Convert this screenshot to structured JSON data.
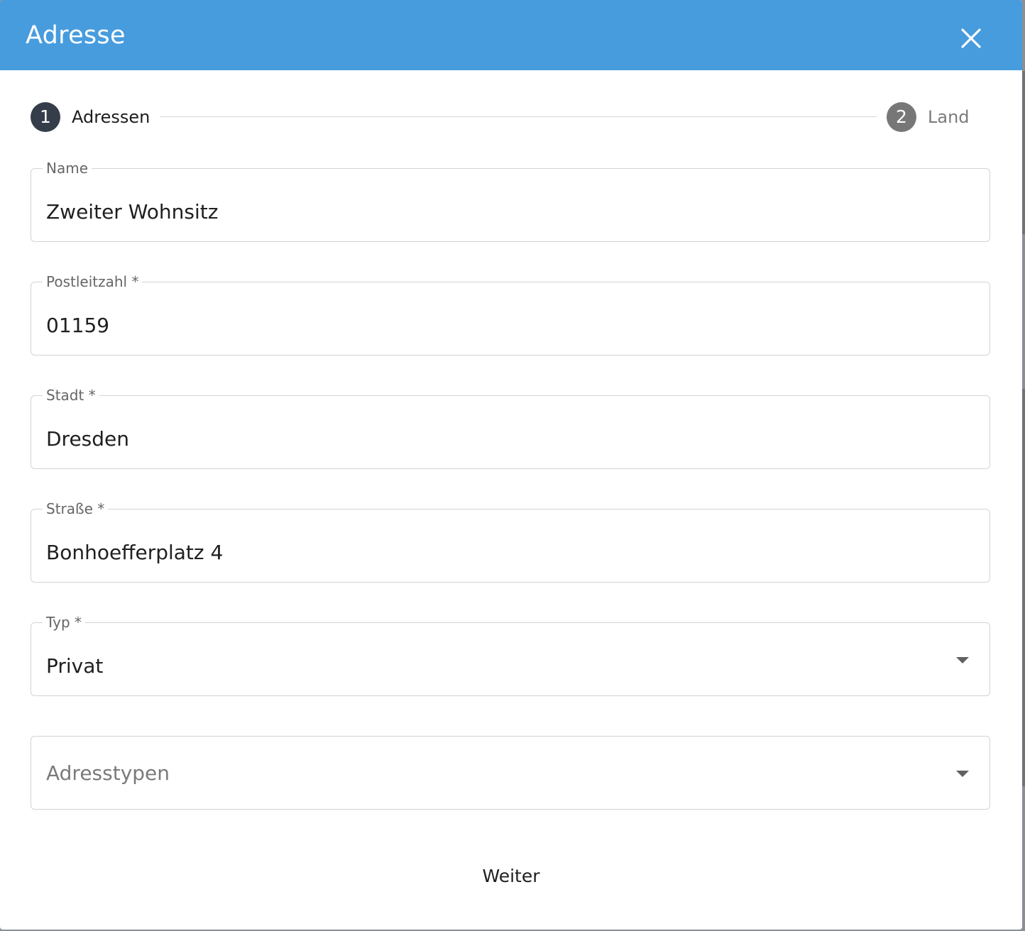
{
  "dialog": {
    "title": "Adresse",
    "close_icon": "close-icon"
  },
  "stepper": {
    "steps": [
      {
        "number": "1",
        "label": "Adressen",
        "state": "active"
      },
      {
        "number": "2",
        "label": "Land",
        "state": "inactive"
      }
    ]
  },
  "form": {
    "name": {
      "label": "Name",
      "value": "Zweiter Wohnsitz"
    },
    "postleitzahl": {
      "label": "Postleitzahl *",
      "value": "01159"
    },
    "stadt": {
      "label": "Stadt *",
      "value": "Dresden"
    },
    "strasse": {
      "label": "Straße *",
      "value": "Bonhoefferplatz 4"
    },
    "typ": {
      "label": "Typ *",
      "value": "Privat",
      "icon": "chevron-down-icon"
    },
    "adresstypen": {
      "placeholder": "Adresstypen",
      "icon": "chevron-down-icon"
    }
  },
  "actions": {
    "next_label": "Weiter"
  },
  "colors": {
    "header": "#479cde",
    "step_active": "#353d4b",
    "step_inactive": "#777777",
    "border": "#d3d3d3"
  }
}
